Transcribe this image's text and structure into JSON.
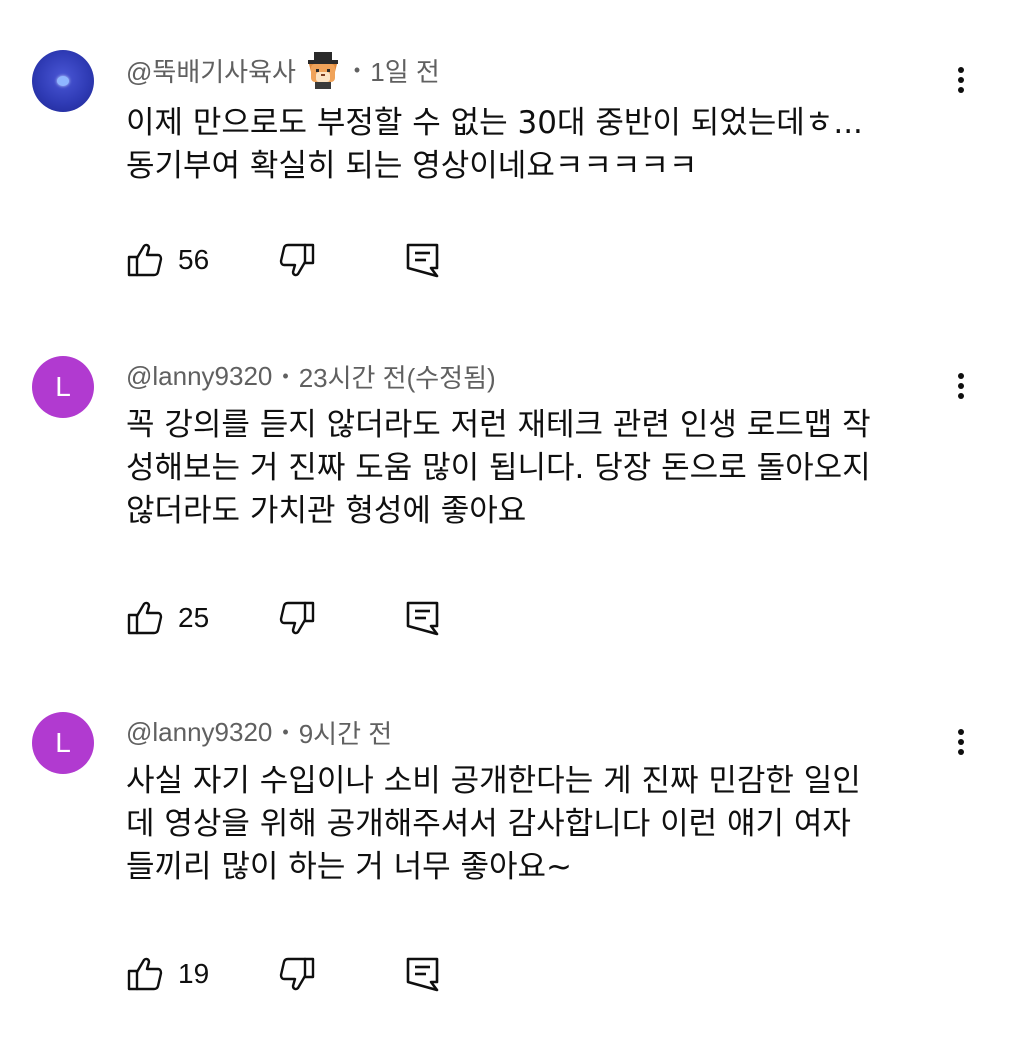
{
  "comments": [
    {
      "author": "@뚝배기사육사",
      "time": "1일 전",
      "text": "이제 만으로도 부정할 수 없는 30대 중반이 되었는데ㅎ...\n동기부여 확실히 되는 영상이네요ㅋㅋㅋㅋㅋ",
      "likes": "56",
      "avatar_letter": "",
      "has_badge": true
    },
    {
      "author": "@lanny9320",
      "time": "23시간 전(수정됨)",
      "text": "꼭 강의를 듣지 않더라도 저런 재테크 관련 인생 로드맵 작\n성해보는 거 진짜 도움 많이 됩니다. 당장 돈으로 돌아오지\n않더라도 가치관 형성에 좋아요",
      "likes": "25",
      "avatar_letter": "L"
    },
    {
      "author": "@lanny9320",
      "time": "9시간 전",
      "text": "사실 자기 수입이나 소비 공개한다는 게 진짜 민감한 일인\n데 영상을 위해 공개해주셔서 감사합니다 이런 얘기 여자\n들끼리 많이 하는 거 너무 좋아요~",
      "likes": "19",
      "avatar_letter": "L"
    }
  ],
  "colors": {
    "avatar_purple": "#b13ad0",
    "avatar_blue": "#2f3bb5",
    "meta_gray": "#606060",
    "text": "#0f0f0f"
  },
  "icons": {
    "like": "thumb-up-icon",
    "dislike": "thumb-down-icon",
    "reply": "reply-comment-icon",
    "more": "more-vert-icon"
  }
}
